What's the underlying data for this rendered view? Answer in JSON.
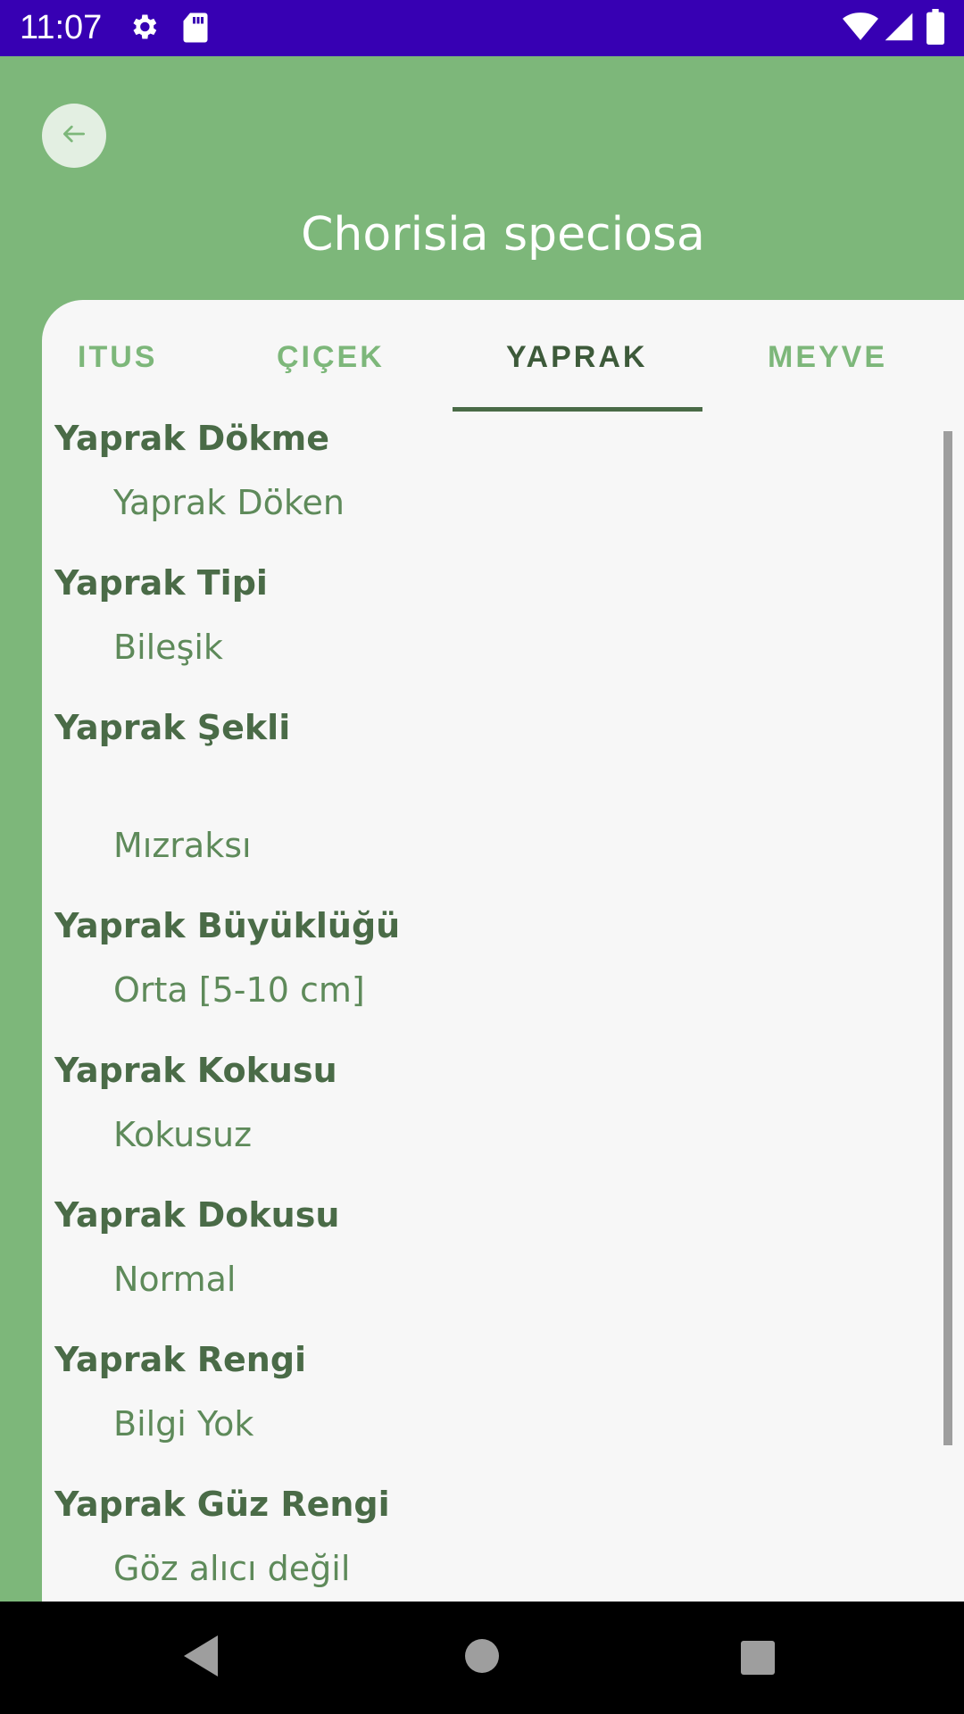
{
  "status_bar": {
    "time": "11:07",
    "icons": [
      "gear-icon",
      "sd-card-icon",
      "wifi-icon",
      "signal-icon",
      "battery-icon"
    ]
  },
  "header": {
    "back_icon": "arrow-left-icon",
    "title": "Chorisia speciosa"
  },
  "tabs": [
    {
      "label": "ITUS",
      "active": false
    },
    {
      "label": "ÇIÇEK",
      "active": false
    },
    {
      "label": "YAPRAK",
      "active": true
    },
    {
      "label": "MEYVE",
      "active": false
    }
  ],
  "details": [
    {
      "label": "Yaprak Dökme",
      "value": "Yaprak Döken"
    },
    {
      "label": "Yaprak Tipi",
      "value": "Bileşik"
    },
    {
      "label": "Yaprak Şekli",
      "value": "Mızraksı"
    },
    {
      "label": "Yaprak Büyüklüğü",
      "value": "Orta [5-10 cm]"
    },
    {
      "label": "Yaprak Kokusu",
      "value": "Kokusuz"
    },
    {
      "label": "Yaprak Dokusu",
      "value": "Normal"
    },
    {
      "label": "Yaprak Rengi",
      "value": "Bilgi Yok"
    },
    {
      "label": "Yaprak Güz Rengi",
      "value": "Göz alıcı değil"
    }
  ],
  "nav_bar": {
    "icons": [
      "back-triangle-icon",
      "home-circle-icon",
      "recents-square-icon"
    ]
  },
  "colors": {
    "header_green": "#7db77a",
    "status_bar": "#3700b3",
    "label_dark_green": "#4a6b47",
    "value_green": "#5e8a5a"
  }
}
